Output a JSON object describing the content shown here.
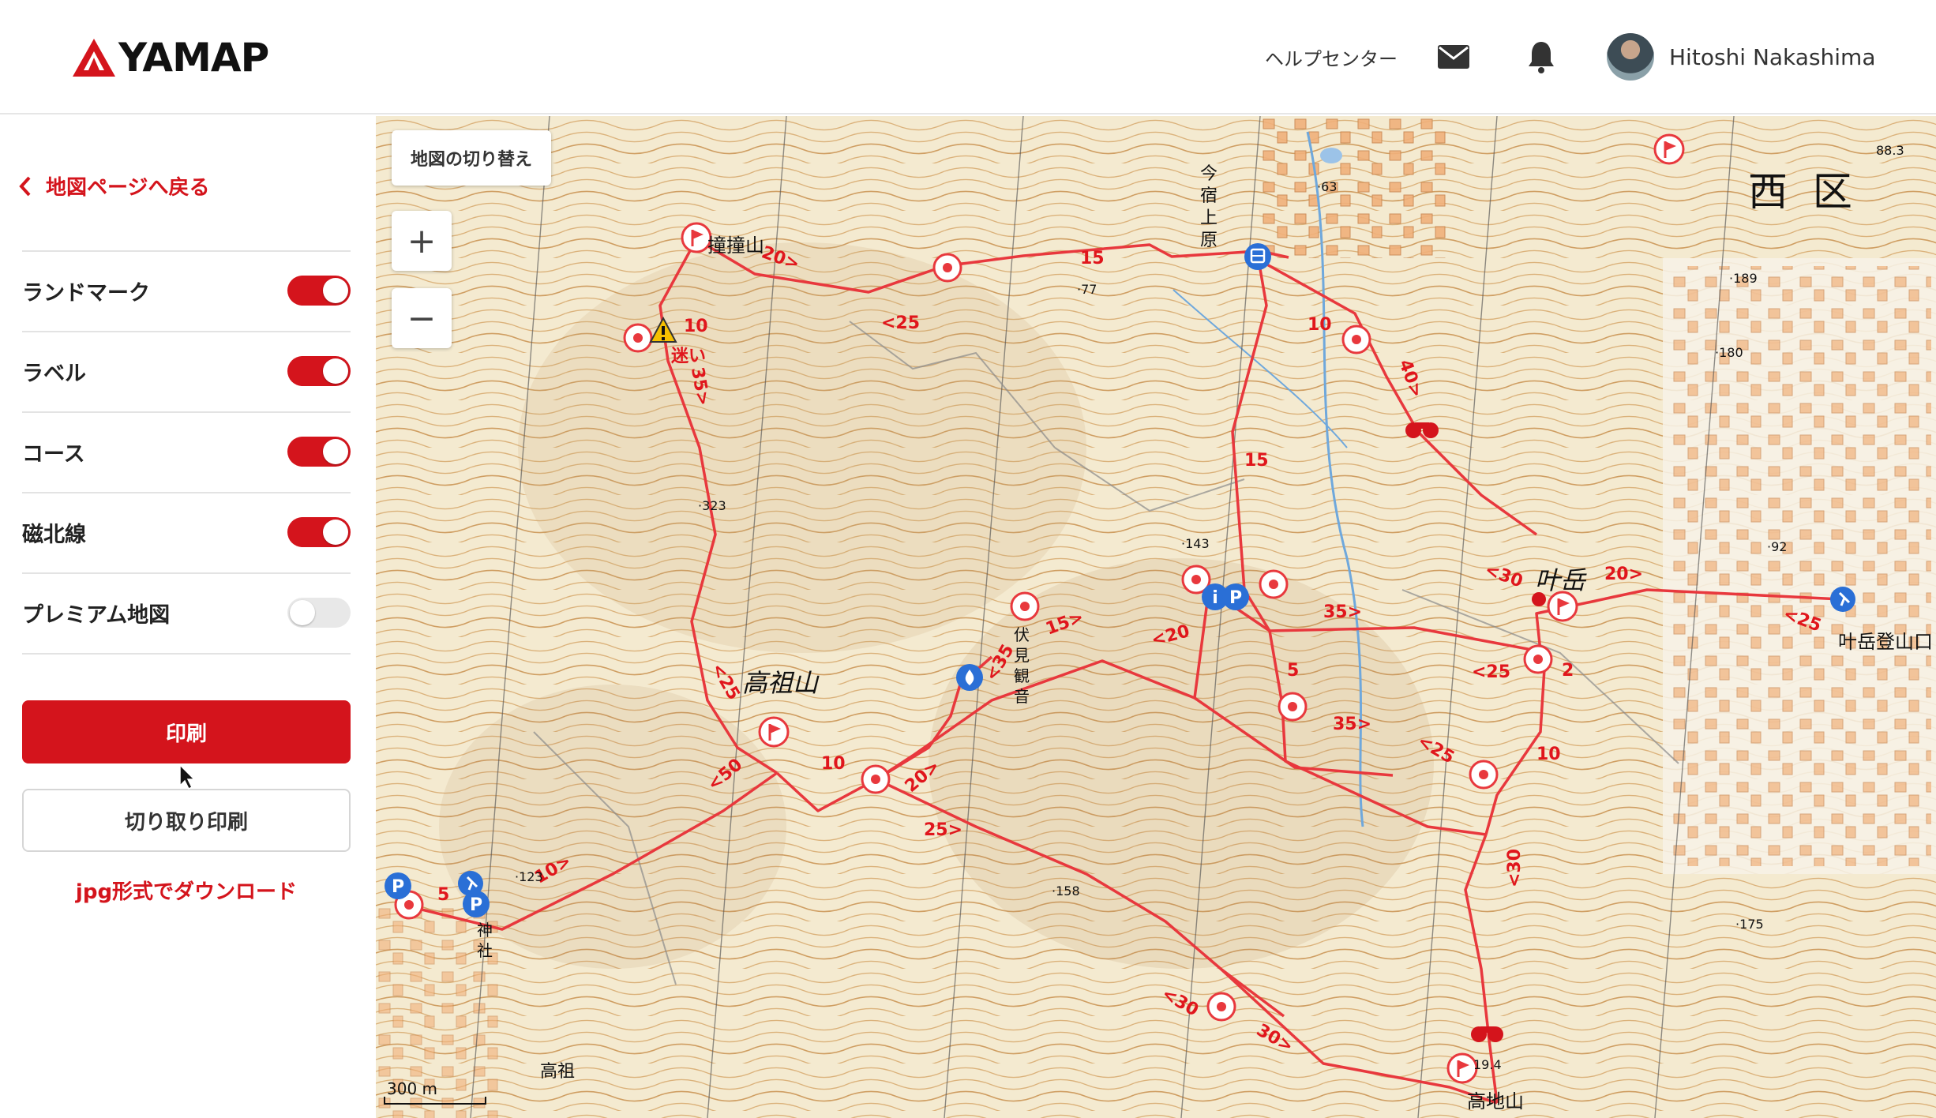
{
  "header": {
    "logo_text": "YAMAP",
    "help_center": "ヘルプセンター",
    "user_name": "Hitoshi Nakashima"
  },
  "sidebar": {
    "back_label": "地図ページへ戻る",
    "toggles": [
      {
        "label": "ランドマーク",
        "state": "on"
      },
      {
        "label": "ラベル",
        "state": "on"
      },
      {
        "label": "コース",
        "state": "on"
      },
      {
        "label": "磁北線",
        "state": "on"
      },
      {
        "label": "プレミアム地図",
        "state": "off"
      }
    ],
    "print_label": "印刷",
    "cut_print_label": "切り取り印刷",
    "download_label": "jpg形式でダウンロード"
  },
  "map": {
    "switch_label": "地図の切り替え",
    "zoom_in": "+",
    "zoom_out": "−",
    "scale_label": "300 m",
    "place_labels": {
      "nishi_ku": "西 区",
      "kanotake": "叶岳",
      "takasoyama": "高祖山",
      "takachiyama": "高地山",
      "takaso": "高祖",
      "kanotake_trailhead": "叶岳登山口",
      "jinja": "神社",
      "fushimi_kannon": "伏見観音",
      "imajuku": "今宿上原",
      "dodoyama": "撞撞山",
      "lost": "迷い"
    },
    "time_labels": [
      "10",
      "35>",
      "20>",
      "<25",
      "15",
      "10",
      "40>",
      "15",
      "<30",
      "20>",
      "35>",
      "2",
      "<25",
      "5",
      "35>",
      "<25",
      "10",
      "<30",
      "15>",
      "<20",
      "<35",
      "<25",
      "<50",
      "10",
      "20>",
      "25>",
      "10>",
      "5",
      "<30",
      "30>",
      "<25"
    ],
    "elevations": [
      "·143",
      "·323",
      "·158",
      "·189",
      "·180",
      "·92",
      "·175",
      "·123",
      "88.3",
      "·63",
      "·77",
      "19.4"
    ],
    "colors": {
      "route": "#e8383d",
      "accent": "#d4141c",
      "water": "#6fa8dc"
    }
  }
}
